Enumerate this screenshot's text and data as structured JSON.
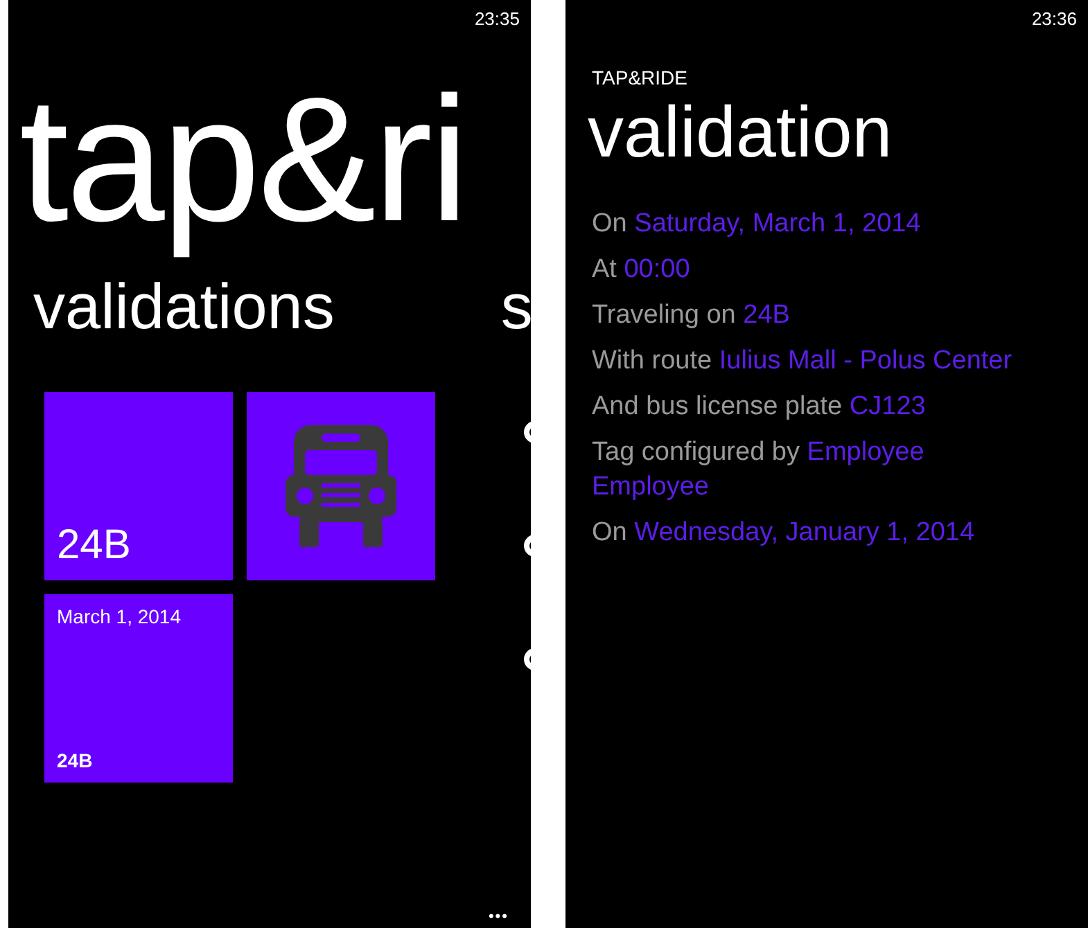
{
  "left_screen": {
    "status_time": "23:35",
    "app_title": "tap&ri",
    "pivot_headers": [
      "validations",
      "s"
    ],
    "tiles": [
      {
        "kind": "route",
        "text": "24B"
      },
      {
        "kind": "bus"
      },
      {
        "kind": "trip",
        "date": "March 1, 2014",
        "route": "24B"
      }
    ],
    "app_bar": {
      "more": "•••"
    }
  },
  "right_screen": {
    "status_time": "23:36",
    "app_name": "TAP&RIDE",
    "page_title": "validation",
    "details": [
      {
        "label": "On",
        "value": "Saturday, March 1, 2014"
      },
      {
        "label": "At",
        "value": "00:00"
      },
      {
        "label": "Traveling on",
        "value": "24B"
      },
      {
        "label": "With route",
        "value": "Iulius Mall - Polus Center"
      },
      {
        "label": "And bus license plate",
        "value": "CJ123"
      },
      {
        "label": "Tag configured by",
        "value": "Employee Employee"
      },
      {
        "label": "On",
        "value": "Wednesday, January 1, 2014"
      }
    ]
  }
}
